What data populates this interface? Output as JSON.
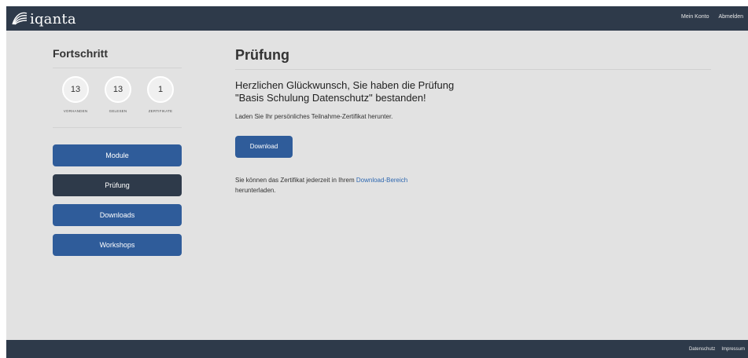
{
  "header": {
    "logo_text": "iqanta",
    "nav": [
      "Mein Konto",
      "Abmelden"
    ]
  },
  "sidebar": {
    "title": "Fortschritt",
    "stats": [
      {
        "value": "13",
        "label": "VORHANDEN"
      },
      {
        "value": "13",
        "label": "GELESEN"
      },
      {
        "value": "1",
        "label": "ZERTIFIKATE"
      }
    ],
    "nav": [
      {
        "label": "Module",
        "active": false
      },
      {
        "label": "Prüfung",
        "active": true
      },
      {
        "label": "Downloads",
        "active": false
      },
      {
        "label": "Workshops",
        "active": false
      }
    ]
  },
  "main": {
    "title": "Prüfung",
    "congrats_line1": "Herzlichen Glückwunsch, Sie haben die Prüfung",
    "congrats_line2": "\"Basis Schulung Datenschutz\" bestanden!",
    "subtitle": "Laden Sie Ihr persönliches Teilnahme-Zertifikat herunter.",
    "download_label": "Download",
    "note_pre": "Sie können das Zertifikat jederzeit in Ihrem ",
    "note_link": "Download-Bereich",
    "note_post": "herunterladen."
  },
  "footer": {
    "nav": [
      "Datenschutz",
      "Impressum"
    ]
  },
  "colors": {
    "topbar": "#2e3a4a",
    "primary_button": "#2f5c9a",
    "active_button": "#2e3a4a",
    "background": "#e2e2e2",
    "link": "#2f68b0"
  }
}
